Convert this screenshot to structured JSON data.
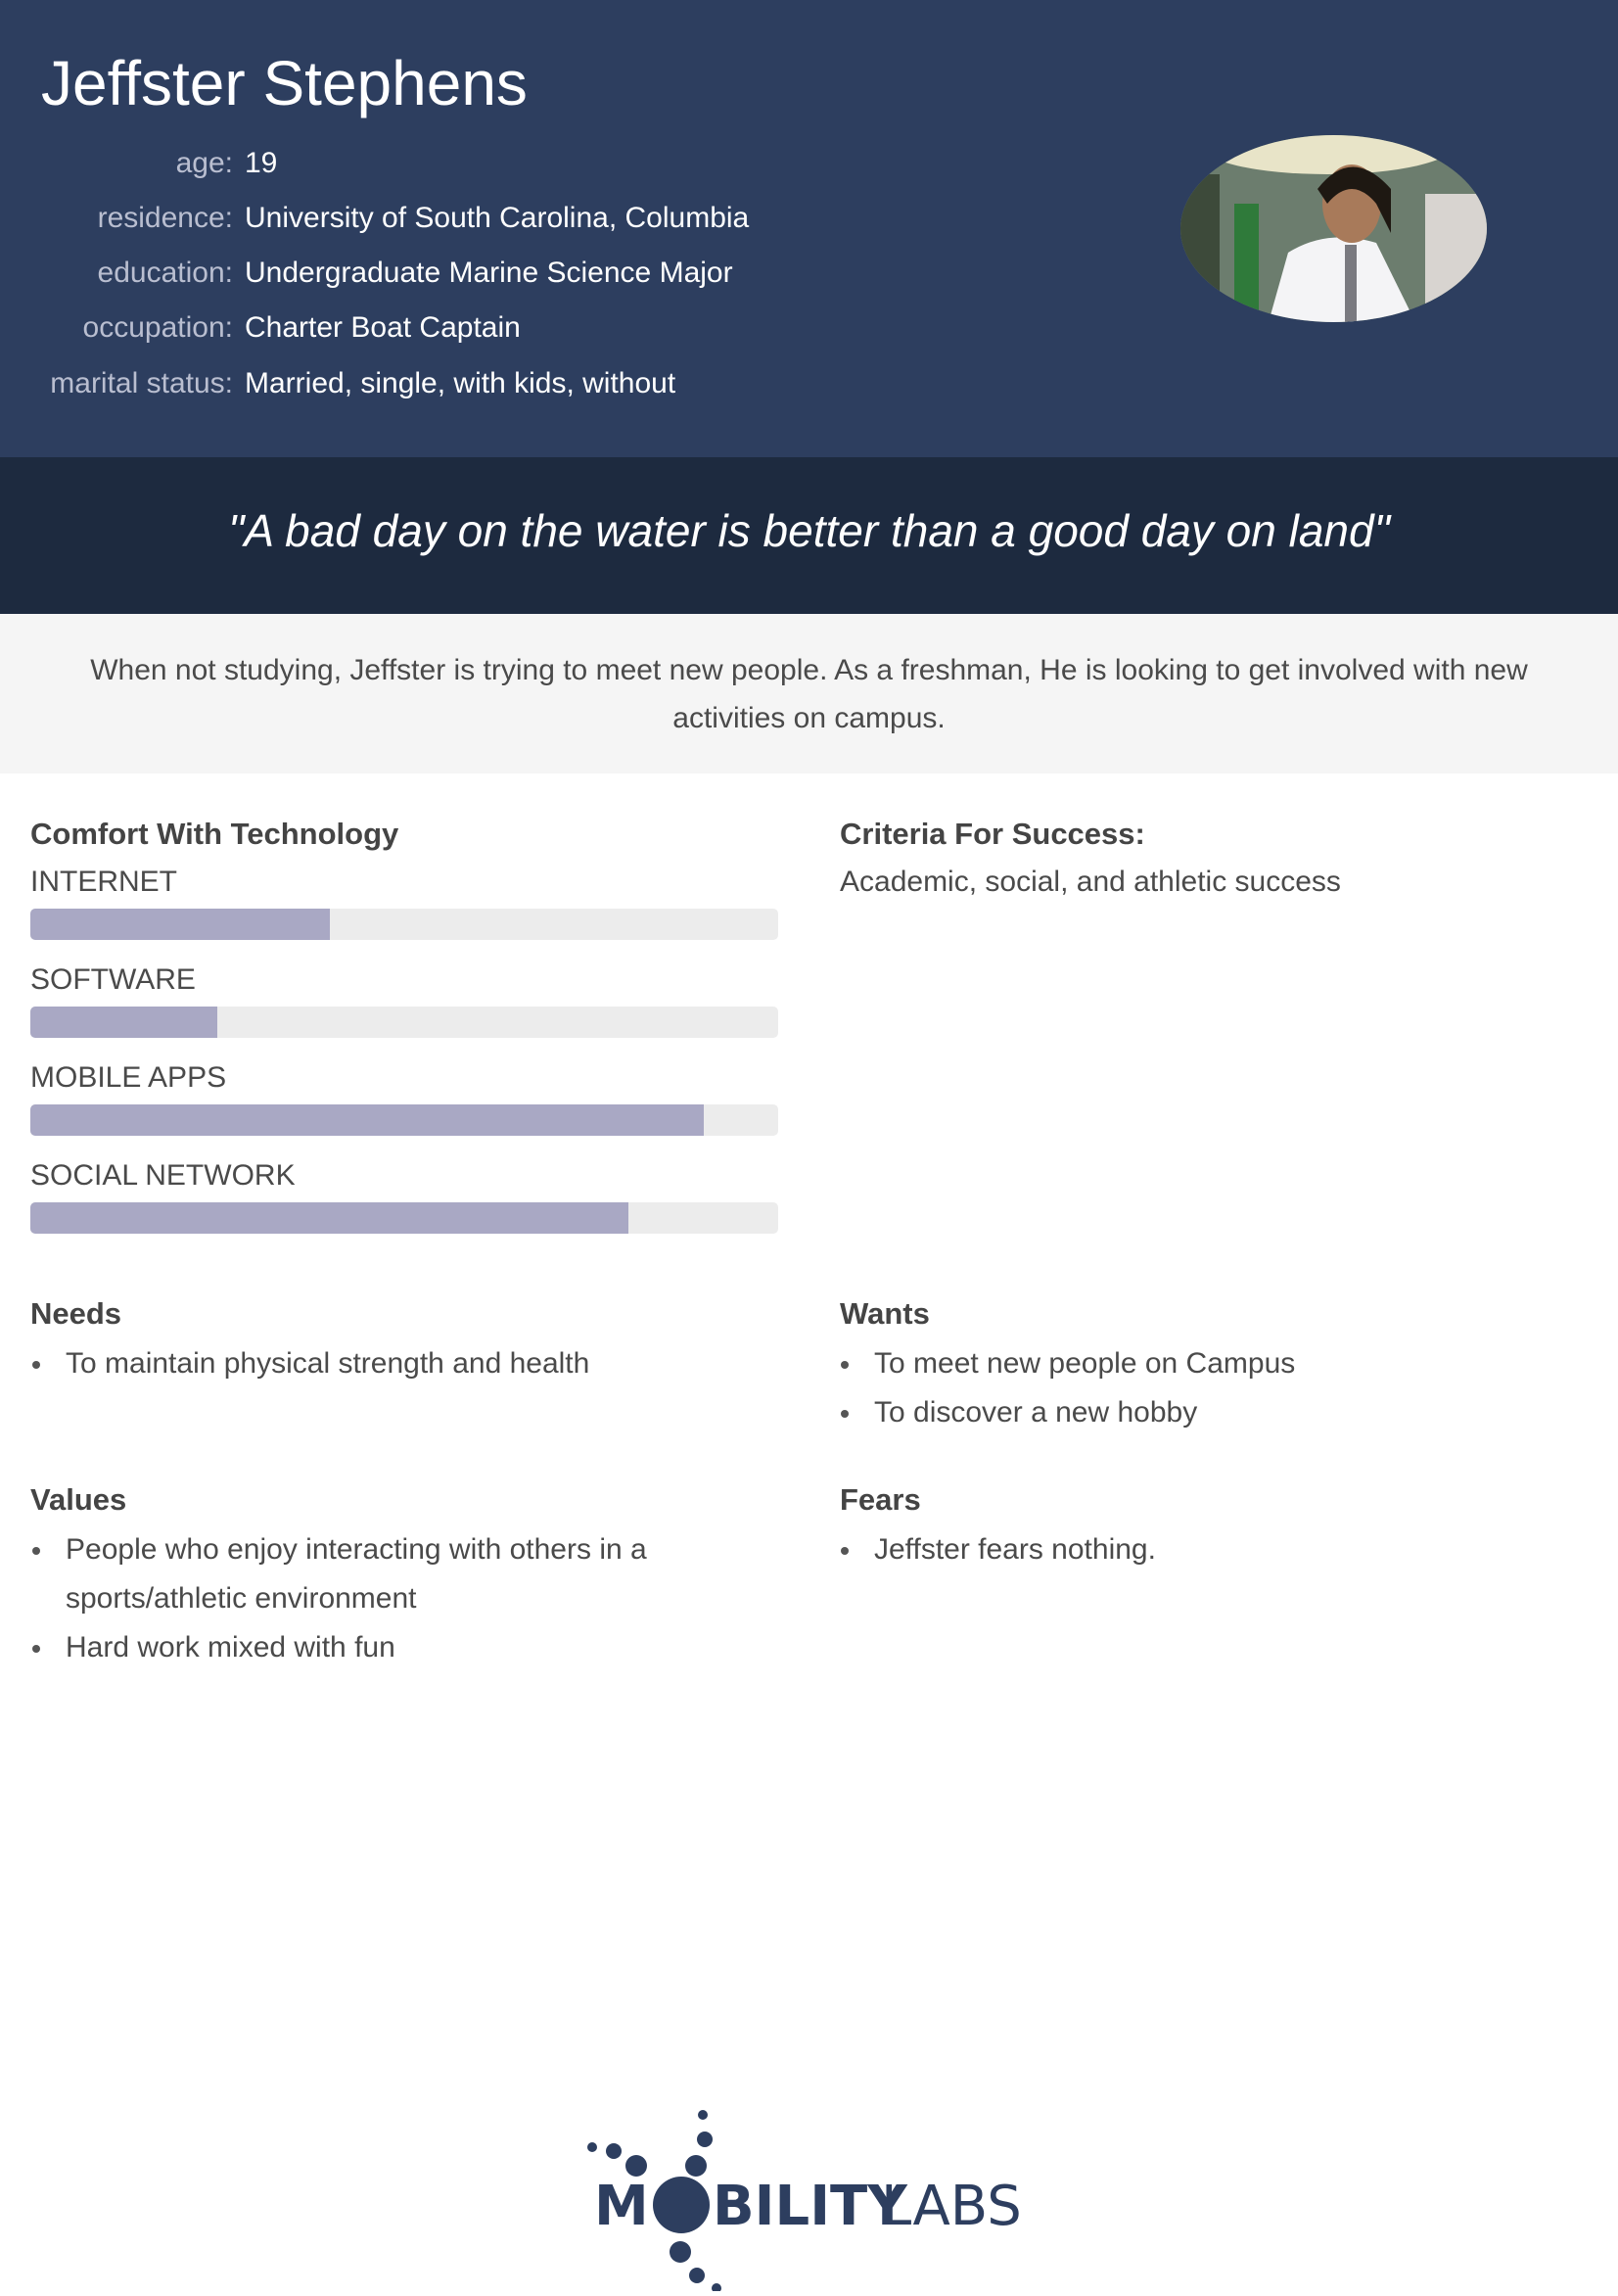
{
  "persona": {
    "name": "Jeffster Stephens",
    "details": [
      {
        "label": "age:",
        "value": "19"
      },
      {
        "label": "residence:",
        "value": "University of South Carolina, Columbia"
      },
      {
        "label": "education:",
        "value": "Undergraduate Marine Science Major"
      },
      {
        "label": "occupation:",
        "value": "Charter Boat Captain"
      },
      {
        "label": "marital status:",
        "value": "Married, single, with kids, without"
      }
    ]
  },
  "quote": "\"A bad day on the water is better than a good day on land\"",
  "description": "When not studying, Jeffster is trying to meet new people. As a freshman, He is looking to get involved with new activities on campus.",
  "technology": {
    "heading": "Comfort With Technology",
    "items": [
      {
        "label": "INTERNET",
        "percent": 40
      },
      {
        "label": "SOFTWARE",
        "percent": 25
      },
      {
        "label": "MOBILE APPS",
        "percent": 90
      },
      {
        "label": "SOCIAL NETWORK",
        "percent": 80
      }
    ]
  },
  "success": {
    "heading": "Criteria For Success:",
    "text": "Academic, social, and athletic success"
  },
  "needs": {
    "heading": "Needs",
    "items": [
      "To maintain physical strength and health"
    ]
  },
  "wants": {
    "heading": "Wants",
    "items": [
      "To meet new people on Campus",
      "To discover a new hobby"
    ]
  },
  "values": {
    "heading": "Values",
    "items": [
      "People who enjoy interacting with others in a sports/athletic environment",
      "Hard work mixed with fun"
    ]
  },
  "fears": {
    "heading": "Fears",
    "items": [
      "Jeffster fears nothing."
    ]
  },
  "logo": {
    "text": "MOBILITY LABS"
  },
  "colors": {
    "header": "#2d3e5f",
    "quote_band": "#1d2a3f",
    "bar_fill": "#a9a8c4",
    "logo": "#2d3e5f"
  }
}
